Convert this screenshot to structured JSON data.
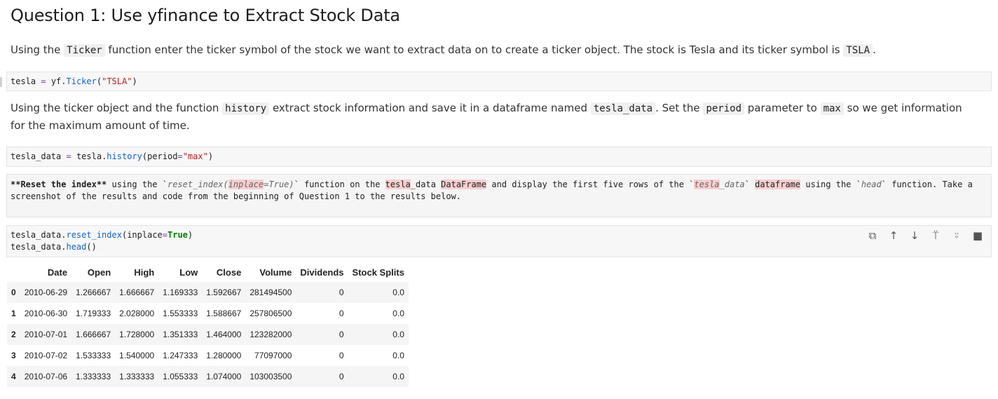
{
  "heading": "Question 1: Use yfinance to Extract Stock Data",
  "para1": {
    "t1": "Using the ",
    "c1": "Ticker",
    "t2": " function enter the ticker symbol of the stock we want to extract data on to create a ticker object. The stock is Tesla and its ticker symbol is ",
    "c2": "TSLA",
    "t3": "."
  },
  "cell1": {
    "var": "tesla ",
    "op": "=",
    "mod": " yf.",
    "fn": "Ticker",
    "open": "(",
    "str": "\"TSLA\"",
    "close": ")"
  },
  "para2": {
    "t1": "Using the ticker object and the function ",
    "c1": "history",
    "t2": " extract stock information and save it in a dataframe named ",
    "c2": "tesla_data",
    "t3": ". Set the ",
    "c3": "period",
    "t4": " parameter to ",
    "c4": "max",
    "t5": " so we get information for the maximum amount of time."
  },
  "cell2": {
    "var": "tesla_data ",
    "op": "=",
    "mod": " tesla.",
    "fn": "history",
    "arg": "(period",
    "op2": "=",
    "str": "\"max\"",
    "close": ")"
  },
  "cell3": {
    "p1": "**Reset the index**",
    "p2": " using the `",
    "p3": "reset_index(",
    "p4": "inplace",
    "p5": "=True)",
    "p6": "` function on the ",
    "p7": "tesla",
    "p8": "_data ",
    "p9": "DataFrame",
    "p10": " and display the first five rows of the `",
    "p11": "tesla",
    "p12": "_data",
    "p13": "` ",
    "p14": "dataframe",
    "p15": " using the `",
    "p16": "head",
    "p17": "` function. Take a screenshot of the results and code from the beginning of Question 1 to the results below."
  },
  "cell4": {
    "l1a": "tesla_data.",
    "l1b": "reset_index",
    "l1c": "(inplace",
    "l1d": "=",
    "l1e": "True",
    "l1f": ")",
    "l2a": "tesla_data.",
    "l2b": "head",
    "l2c": "()"
  },
  "toolbar_icons": [
    "copy-icon",
    "arrow-up-icon",
    "arrow-down-icon",
    "insert-above-icon",
    "insert-below-icon",
    "delete-icon"
  ],
  "table": {
    "columns": [
      "",
      "Date",
      "Open",
      "High",
      "Low",
      "Close",
      "Volume",
      "Dividends",
      "Stock Splits"
    ],
    "rows": [
      [
        "0",
        "2010-06-29",
        "1.266667",
        "1.666667",
        "1.169333",
        "1.592667",
        "281494500",
        "0",
        "0.0"
      ],
      [
        "1",
        "2010-06-30",
        "1.719333",
        "2.028000",
        "1.553333",
        "1.588667",
        "257806500",
        "0",
        "0.0"
      ],
      [
        "2",
        "2010-07-01",
        "1.666667",
        "1.728000",
        "1.351333",
        "1.464000",
        "123282000",
        "0",
        "0.0"
      ],
      [
        "3",
        "2010-07-02",
        "1.533333",
        "1.540000",
        "1.247333",
        "1.280000",
        "77097000",
        "0",
        "0.0"
      ],
      [
        "4",
        "2010-07-06",
        "1.333333",
        "1.333333",
        "1.055333",
        "1.074000",
        "103003500",
        "0",
        "0.0"
      ]
    ]
  }
}
